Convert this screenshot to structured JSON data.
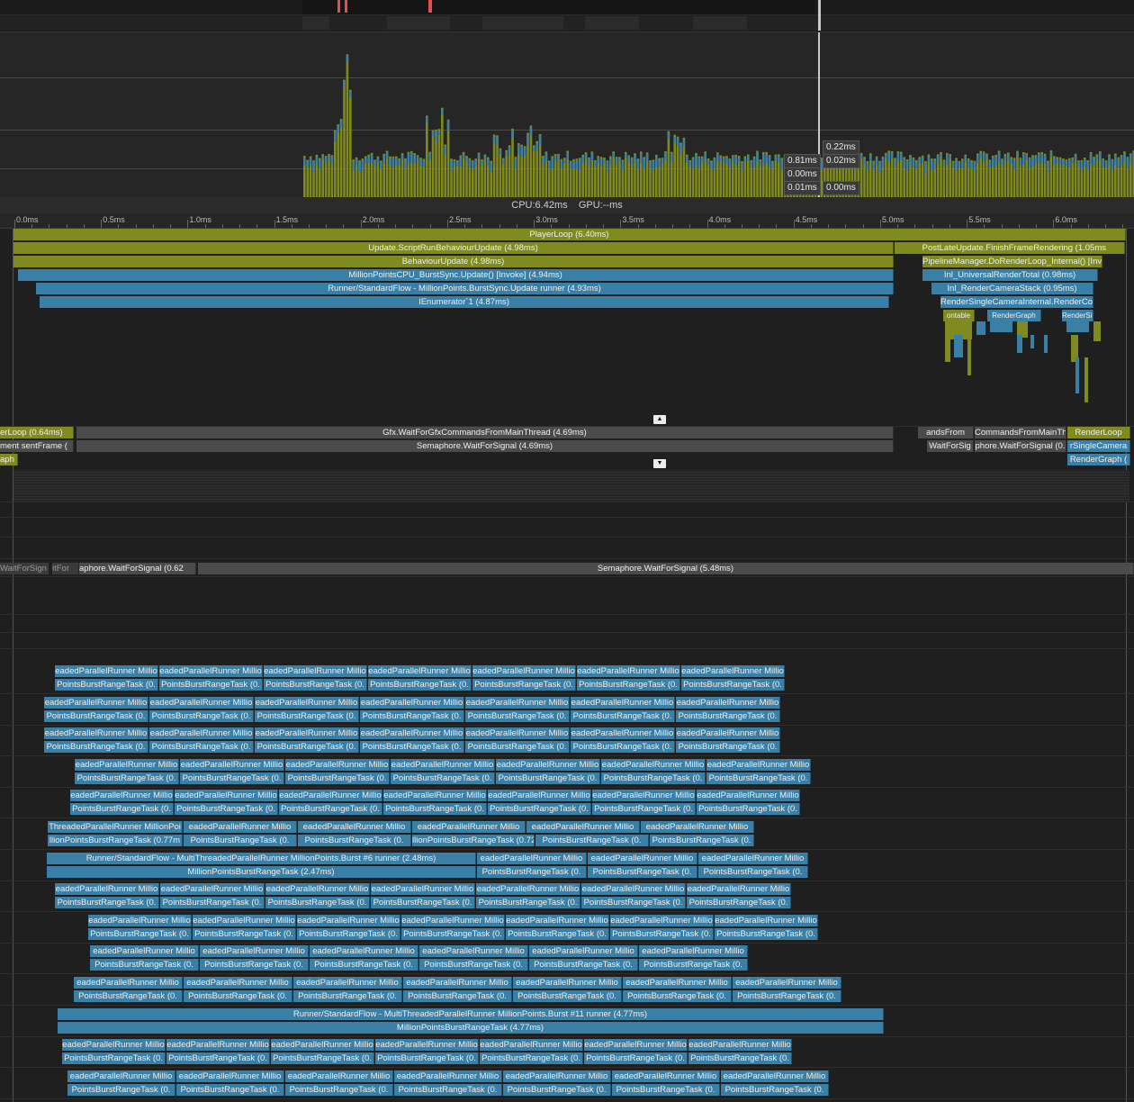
{
  "tooltips": {
    "t1": "0.22ms",
    "t2a": "0.81ms",
    "t2b": "0.02ms",
    "t3": "0.00ms",
    "t4a": "0.01ms",
    "t4b": "0.00ms"
  },
  "summary": {
    "cpu": "CPU:6.42ms",
    "gpu": "GPU:--ms"
  },
  "ruler": {
    "ticks": [
      "0.0ms",
      "0.5ms",
      "1.0ms",
      "1.5ms",
      "2.0ms",
      "2.5ms",
      "3.0ms",
      "3.5ms",
      "4.0ms",
      "4.5ms",
      "5.0ms",
      "5.5ms",
      "6.0ms"
    ]
  },
  "main_thread": {
    "player_loop": "PlayerLoop (6.40ms)",
    "script_run": "Update.ScriptRunBehaviourUpdate (4.98ms)",
    "post_late": "PostLateUpdate.FinishFrameRendering (1.05ms",
    "behaviour_update": "BehaviourUpdate (4.98ms)",
    "pipeline": "PipelineManager.DoRenderLoop_Internal() [Invol",
    "million_cpu": "MillionPointsCPU_BurstSync.Update() [Invoke] (4.94ms)",
    "universal_render": "Inl_UniversalRenderTotal (0.98ms)",
    "runner_flow": "Runner/StandardFlow - MillionPoints.BurstSync.Update runner (4.93ms)",
    "render_camera_stack": "Inl_RenderCameraStack (0.95ms)",
    "ienumerator": "IEnumerator`1 (4.87ms)",
    "render_single": "RenderSingleCameraInternal.RenderContext",
    "small_a": "ontable",
    "small_b": "RenderGraph",
    "small_c": "RenderSingleCam"
  },
  "render_thread": {
    "left_loop": "erLoop (0.64ms)",
    "gfx_wait": "Gfx.WaitForGfxCommandsFromMainThread (4.69ms)",
    "commands_from": "andsFrom",
    "commands_from2": "CommandsFromMainTh",
    "render_loop": "RenderLoop",
    "present_frame": "ment  sentFrame (",
    "semaphore": "Semaphore.WaitForSignal (4.69ms)",
    "wait_for_sig": "WaitForSig",
    "semaphore_short": "phore.WaitForSignal (0.",
    "single_camera": "rSingleCamera",
    "graph_left": "aph",
    "render_graph": "RenderGraph ("
  },
  "job_thread": {
    "left1": "WaitForSign",
    "left2": "itFor",
    "left3": "aphore.WaitForSignal (0.62",
    "main": "Semaphore.WaitForSignal (5.48ms)"
  },
  "workers": {
    "runner": "eadedParallelRunner Millio",
    "task": "PointsBurstRangeTask (0.",
    "w6_runner_a": "ThreadedParallelRunner MillionPoi",
    "w6_task_a": "llionPointsBurstRangeTask (0.77m",
    "w6_task_c": "llionPointsBurstRangeTask (0.72",
    "w7_runner": "Runner/StandardFlow - MultiThreadedParallelRunner MillionPoints.Burst #6 runner (2.48ms)",
    "w7_task": "MillionPointsBurstRangeTask (2.47ms)",
    "w11_runner": "Runner/StandardFlow - MultiThreadedParallelRunner MillionPoints.Burst #11 runner (4.77ms)",
    "w11_task": "MillionPointsBurstRangeTask (4.77ms)"
  },
  "colors": {
    "cpu_olive": "#7f8a1f",
    "job_blue": "#3a7fa6",
    "marker_red": "#e05050"
  }
}
